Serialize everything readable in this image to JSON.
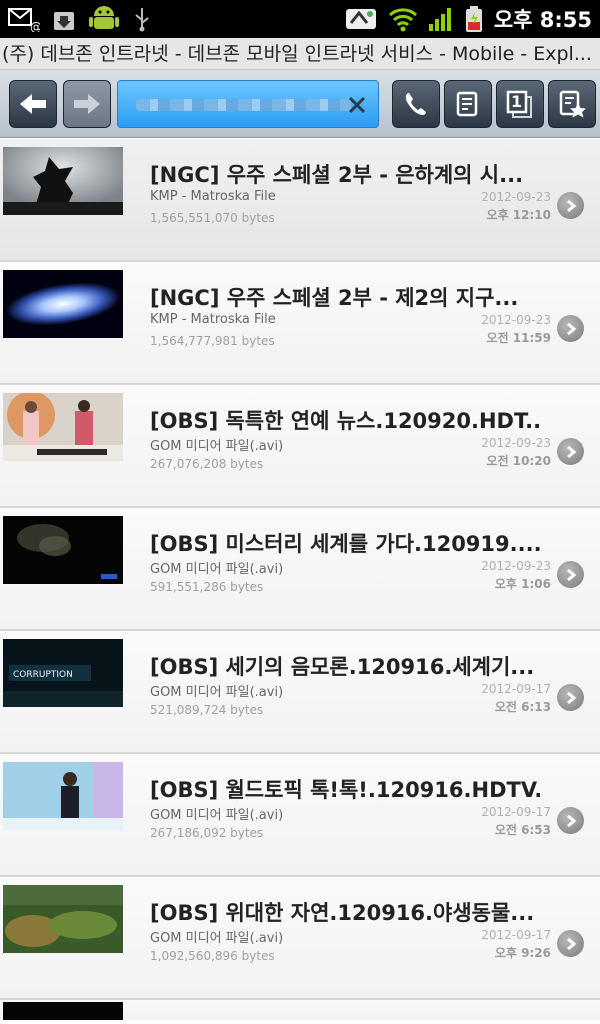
{
  "status_bar": {
    "time": "오후 8:55",
    "left_icons": [
      "email-icon",
      "download-icon",
      "android-icon",
      "usb-icon"
    ],
    "right_icons": [
      "wifi-direct-icon",
      "wifi-icon",
      "signal-icon",
      "battery-icon"
    ]
  },
  "title_bar": {
    "title": "(주) 데브존 인트라넷 - 데브존 모바일 인트라넷 서비스 - Mobile - Expl..."
  },
  "toolbar": {
    "back_icon": "arrow-left-icon",
    "forward_icon": "arrow-right-icon",
    "url_value": "",
    "clear_icon": "close-icon",
    "call_icon": "phone-icon",
    "memo_icon": "note-icon",
    "tabs_count": "1",
    "bookmark_icon": "bookmark-star-icon"
  },
  "files": [
    {
      "name": "[NGC] 우주 스페셜 2부 - 은하계의 시...",
      "type": "KMP - Matroska File",
      "size": "1,565,551,070 bytes",
      "date": "2012-09-23",
      "time": "오후 12:10"
    },
    {
      "name": "[NGC] 우주 스페셜 2부 - 제2의 지구...",
      "type": "KMP - Matroska File",
      "size": "1,564,777,981 bytes",
      "date": "2012-09-23",
      "time": "오전 11:59"
    },
    {
      "name": "[OBS] 독특한 연예 뉴스.120920.HDT...",
      "type": "GOM 미디어 파일(.avi)",
      "size": "267,076,208 bytes",
      "date": "2012-09-23",
      "time": "오전 10:20"
    },
    {
      "name": "[OBS] 미스터리 세계를 가다.120919....",
      "type": "GOM 미디어 파일(.avi)",
      "size": "591,551,286 bytes",
      "date": "2012-09-23",
      "time": "오후 1:06"
    },
    {
      "name": "[OBS] 세기의 음모론.120916.세계기...",
      "type": "GOM 미디어 파일(.avi)",
      "size": "521,089,724 bytes",
      "date": "2012-09-17",
      "time": "오전 6:13"
    },
    {
      "name": "[OBS] 월드토픽 톡!톡!.120916.HDTV....",
      "type": "GOM 미디어 파일(.avi)",
      "size": "267,186,092 bytes",
      "date": "2012-09-17",
      "time": "오전 6:53"
    },
    {
      "name": "[OBS] 위대한 자연.120916.야생동물...",
      "type": "GOM 미디어 파일(.avi)",
      "size": "1,092,560,896 bytes",
      "date": "2012-09-17",
      "time": "오후 9:26"
    }
  ]
}
